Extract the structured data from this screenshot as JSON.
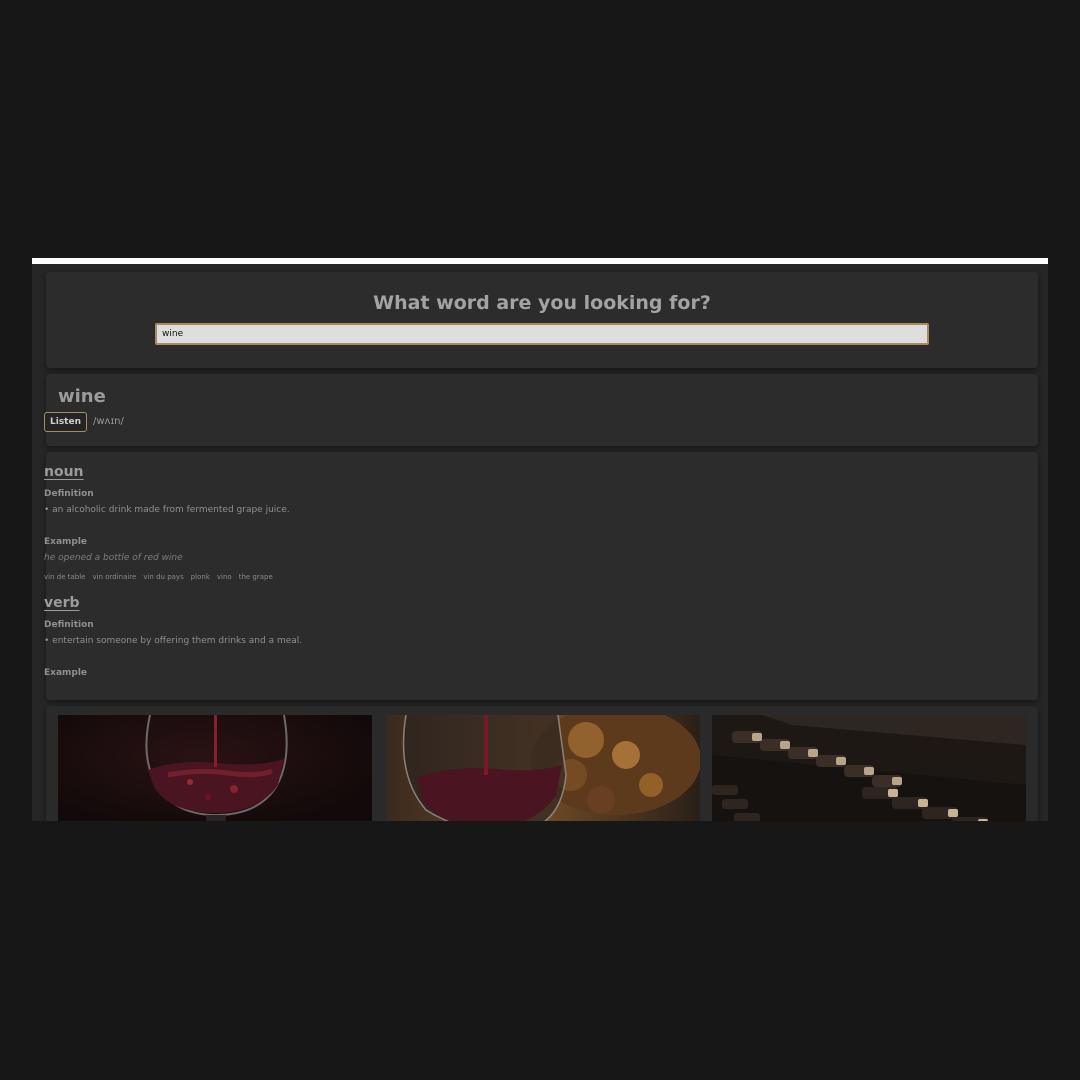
{
  "search": {
    "title": "What word are you looking for?",
    "value": "wine"
  },
  "word": {
    "title": "wine",
    "listen_label": "Listen",
    "phonetic": "/wʌɪn/"
  },
  "meanings": [
    {
      "part_of_speech": "noun",
      "definition_label": "Definition",
      "definition": "• an alcoholic drink made from fermented grape juice.",
      "example_label": "Example",
      "example": "he opened a bottle of red wine",
      "synonyms": [
        "vin de table",
        "vin ordinaire",
        "vin du pays",
        "plonk",
        "vino",
        "the grape"
      ]
    },
    {
      "part_of_speech": "verb",
      "definition_label": "Definition",
      "definition": "• entertain someone by offering them drinks and a meal.",
      "example_label": "Example"
    }
  ],
  "colors": {
    "page_background": "#171717",
    "panel_background": "#2c2c2c",
    "accent_border": "#a88a5e",
    "text_muted": "#9b9b9b"
  }
}
